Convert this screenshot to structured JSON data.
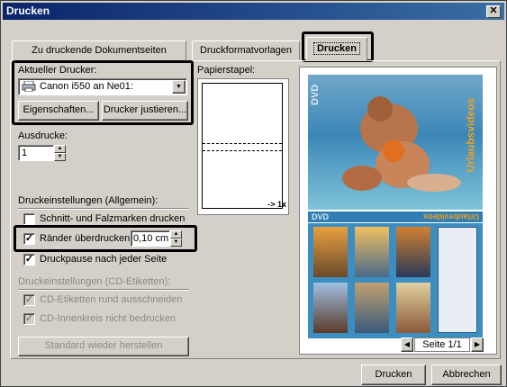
{
  "window": {
    "title": "Drucken",
    "close_glyph": "✕"
  },
  "tabs": [
    {
      "label": "Zu druckende Dokumentseiten",
      "active": false
    },
    {
      "label": "Druckformatvorlagen",
      "active": false
    },
    {
      "label": "Drucken",
      "active": true
    }
  ],
  "printer": {
    "label": "Aktueller Drucker:",
    "selected": "Canon i550 an Ne01:",
    "properties_button": "Eigenschaften...",
    "adjust_button": "Drucker justieren..."
  },
  "copies": {
    "label": "Ausdrucke:",
    "value": "1"
  },
  "general": {
    "heading": "Druckeinstellungen (Allgemein):",
    "cut_marks": {
      "label": "Schnitt- und Falzmarken drucken",
      "checked": false
    },
    "margins": {
      "label": "Ränder überdrucken",
      "checked": true,
      "value": "0,10 cm"
    },
    "pause": {
      "label": "Druckpause nach jeder Seite",
      "checked": true
    }
  },
  "cd": {
    "heading": "Druckeinstellungen (CD-Etiketten):",
    "cut_labels": {
      "label": "CD-Etiketten rund ausschneiden",
      "checked": true
    },
    "inner_circle": {
      "label": "CD-Innenkreis nicht bedrucken",
      "checked": true
    }
  },
  "restore_button": "Standard wieder herstellen",
  "paper_stack": {
    "label": "Papierstapel:",
    "arrow_text": "-> 1x"
  },
  "preview": {
    "page_label": "Seite 1/1",
    "cover_title": "Urlaubsvideos",
    "cover_side": "DVD",
    "strip_title": "Urlaubsvideos",
    "strip_side": "DVD"
  },
  "footer": {
    "print_button": "Drucken",
    "cancel_button": "Abbrechen"
  }
}
